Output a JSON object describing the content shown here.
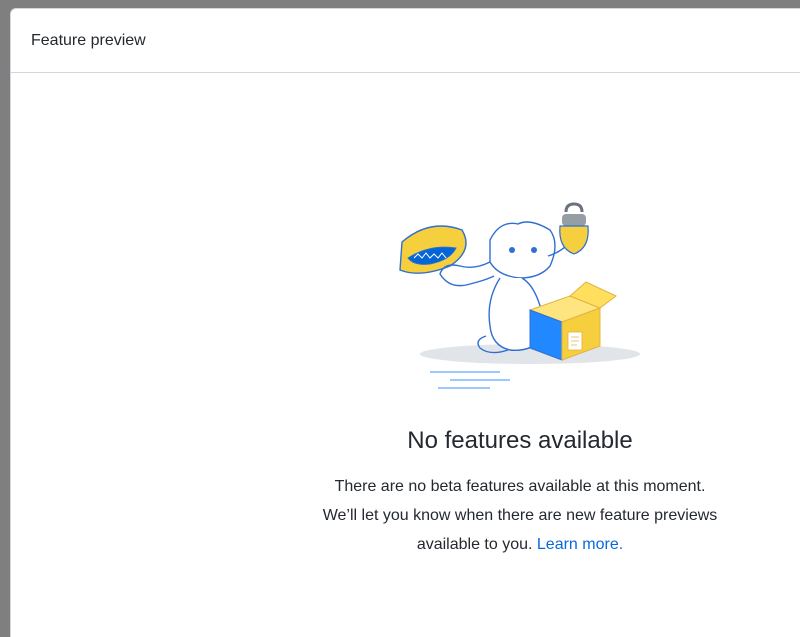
{
  "dialog": {
    "title": "Feature preview"
  },
  "blankslate": {
    "illustration": "octocat-unboxing-illustration",
    "heading": "No features available",
    "line1": "There are no beta features available at this moment.",
    "line2": "We’ll let you know when there are new feature previews",
    "line3_prefix": "available to you. ",
    "link_label": "Learn more."
  },
  "colors": {
    "link": "#0969da",
    "border": "#d0d7de",
    "text": "#24292f",
    "accent_yellow": "#f6cf3e",
    "accent_blue": "#0366d6"
  }
}
